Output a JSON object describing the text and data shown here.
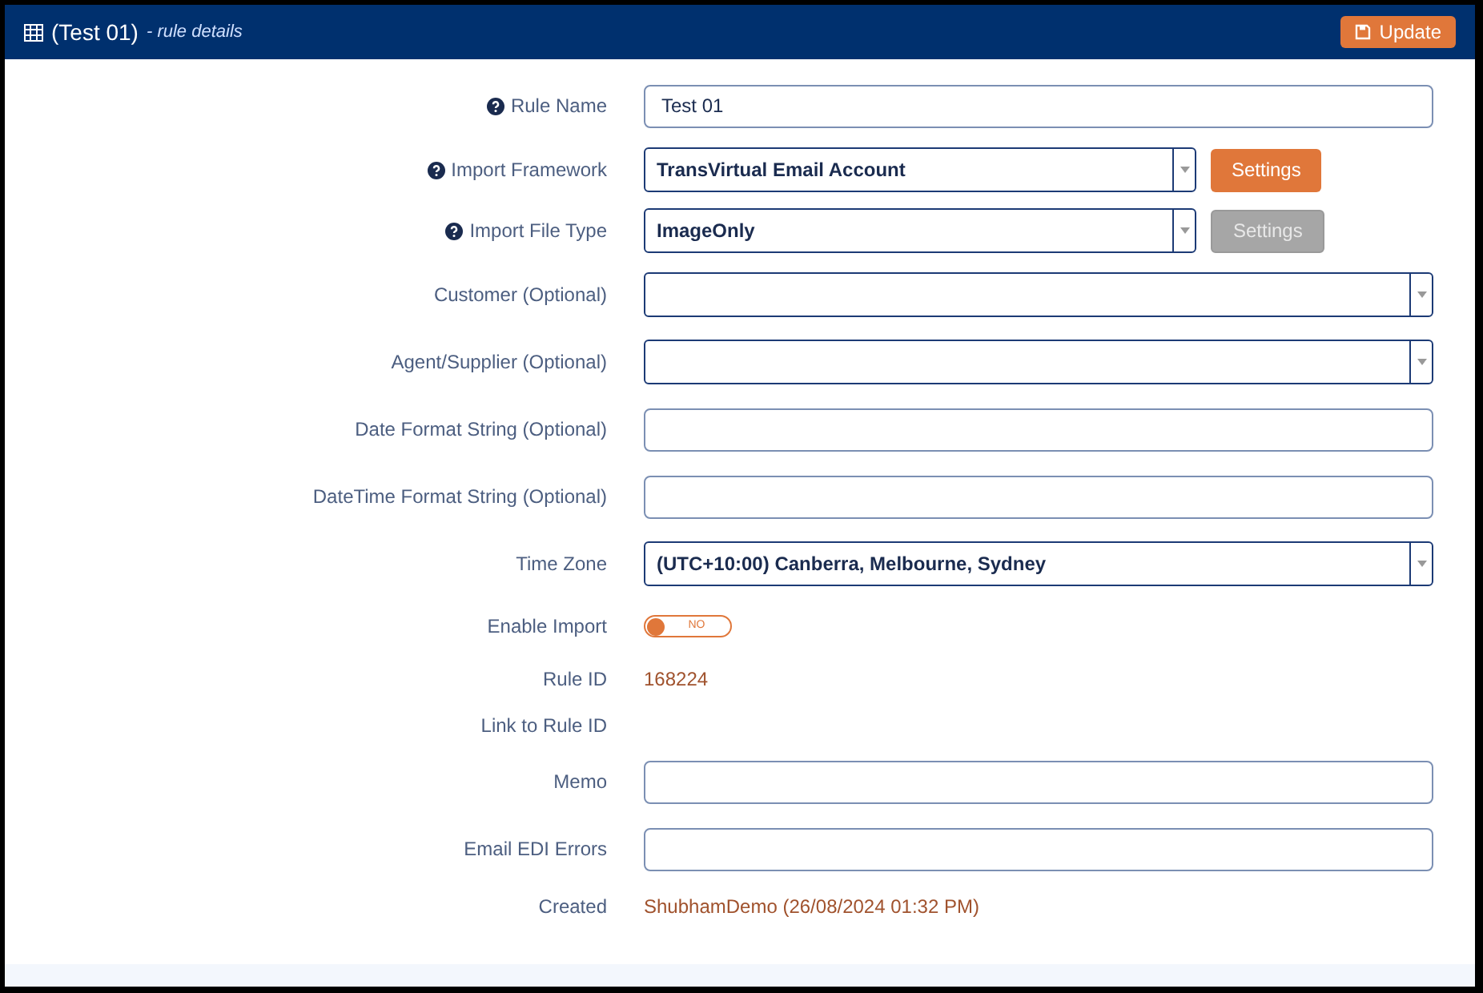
{
  "header": {
    "title": "(Test 01)",
    "subtitle": "- rule details",
    "update_button": "Update"
  },
  "fields": [
    {
      "kind": "text",
      "label": "Rule Name",
      "help": true,
      "value": "Test 01"
    },
    {
      "kind": "select",
      "label": "Import Framework",
      "help": true,
      "value": "TransVirtual Email Account",
      "settings": {
        "label": "Settings",
        "disabled": false
      }
    },
    {
      "kind": "select",
      "label": "Import File Type",
      "help": true,
      "value": "ImageOnly",
      "settings": {
        "label": "Settings",
        "disabled": true
      }
    },
    {
      "kind": "select",
      "label": "Customer (Optional)"
    },
    {
      "kind": "select",
      "label": "Agent/Supplier (Optional)"
    },
    {
      "kind": "text",
      "label": "Date Format String (Optional)"
    },
    {
      "kind": "text",
      "label": "DateTime Format String (Optional)"
    },
    {
      "kind": "select",
      "label": "Time Zone",
      "value": "(UTC+10:00) Canberra, Melbourne, Sydney"
    },
    {
      "kind": "toggle",
      "label": "Enable Import",
      "on": false,
      "state_label": "NO"
    },
    {
      "kind": "value",
      "label": "Rule ID",
      "value": "168224"
    },
    {
      "kind": "value",
      "label": "Link to Rule ID"
    },
    {
      "kind": "text",
      "label": "Memo"
    },
    {
      "kind": "text",
      "label": "Email EDI Errors"
    },
    {
      "kind": "value",
      "label": "Created",
      "value": "ShubhamDemo (26/08/2024 01:32 PM)"
    }
  ]
}
